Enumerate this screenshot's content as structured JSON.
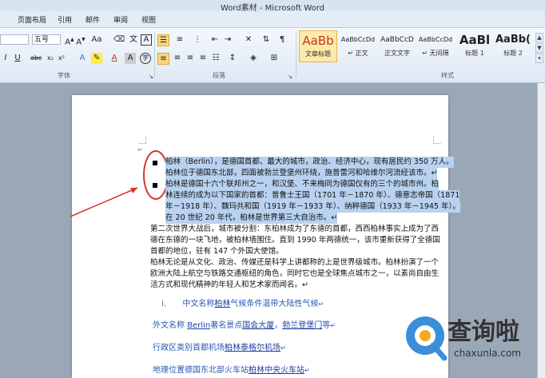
{
  "window": {
    "title": "Word素材 - Microsoft Word"
  },
  "tabs": [
    "页面布局",
    "引用",
    "邮件",
    "审阅",
    "视图"
  ],
  "ribbon": {
    "font_group_label": "字体",
    "paragraph_group_label": "段落",
    "styles_group_label": "样式",
    "font_size": "五号",
    "font_name": "",
    "styles": [
      {
        "preview": "AaBb",
        "name": "文章标题",
        "color": "#c0392b"
      },
      {
        "preview": "AaBbCcDd",
        "name": "↵ 正文",
        "color": "#222222"
      },
      {
        "preview": "AaBbCcD",
        "name": "正文文字",
        "color": "#222222"
      },
      {
        "preview": "AaBbCcDd",
        "name": "↵ 无间隔",
        "color": "#222222"
      },
      {
        "preview": "AaBl",
        "name": "标题 1",
        "color": "#222222"
      },
      {
        "preview": "AaBb(",
        "name": "标题 2",
        "color": "#222222"
      }
    ]
  },
  "document": {
    "bullet1": {
      "line1": "柏林（Berlin），是德国首都、最大的城市，政治、经济中心，现有居民约 350 万人。",
      "line2": "柏林位于德国东北部，四面被勃兰登堡州环绕，施普雷河和哈维尔河流经该市。↵"
    },
    "bullet2": {
      "line1": "柏林是德国十六个联邦州之一，和汉堡、不来梅同为德国仅有的三个的城市州。柏",
      "line2": "林连续的成为以下国家的首都：普鲁士王国（1701 年－1870 年）、德意志帝国（1871",
      "line3": "年－1918 年）、魏玛共和国（1919 年－1933 年）、纳粹德国（1933 年－1945 年）。",
      "line4": "在 20 世纪 20 年代，柏林是世界第三大自治市。↵"
    },
    "para2": [
      "第二次世界大战后，城市被分割：东柏林成为了东德的首都，西西柏林事实上成为了西",
      "德在东德的一块飞地，被柏林墙围住。直到 1990 年两德统一，该市重新获得了全德国",
      "首都的地位，驻有 147 个外国大使馆。"
    ],
    "para3": [
      "柏林无论是从文化、政治、传媒还是科学上讲都称的上是世界级城市。柏林扮演了一个",
      "欧洲大陆上航空与铁路交通枢纽的角色，同时它也是全球焦点城市之一，以素尚自由生",
      "活方式和现代精神的年轻人和艺术家而闻名。↵"
    ],
    "list_item": {
      "marker": "i.",
      "pre": "中文名称",
      "link": "柏林",
      "post": "气候条件温带大陆性气候"
    },
    "line_foreign": {
      "pre": "外文名称 ",
      "link1": "Berlin",
      "mid": "著名景点",
      "link2": "国会大厦",
      "sep": "，",
      "link3": "勃兰登堡门",
      "post": "等"
    },
    "line_admin": {
      "pre": "行政区类别首都机场",
      "link": "柏林泰格尔机场"
    },
    "line_geo": {
      "pre": "地理位置德国东北部火车站",
      "link": "柏林中央火车站"
    }
  },
  "watermark": {
    "text": "查询啦",
    "url": "chaxunla.com"
  }
}
